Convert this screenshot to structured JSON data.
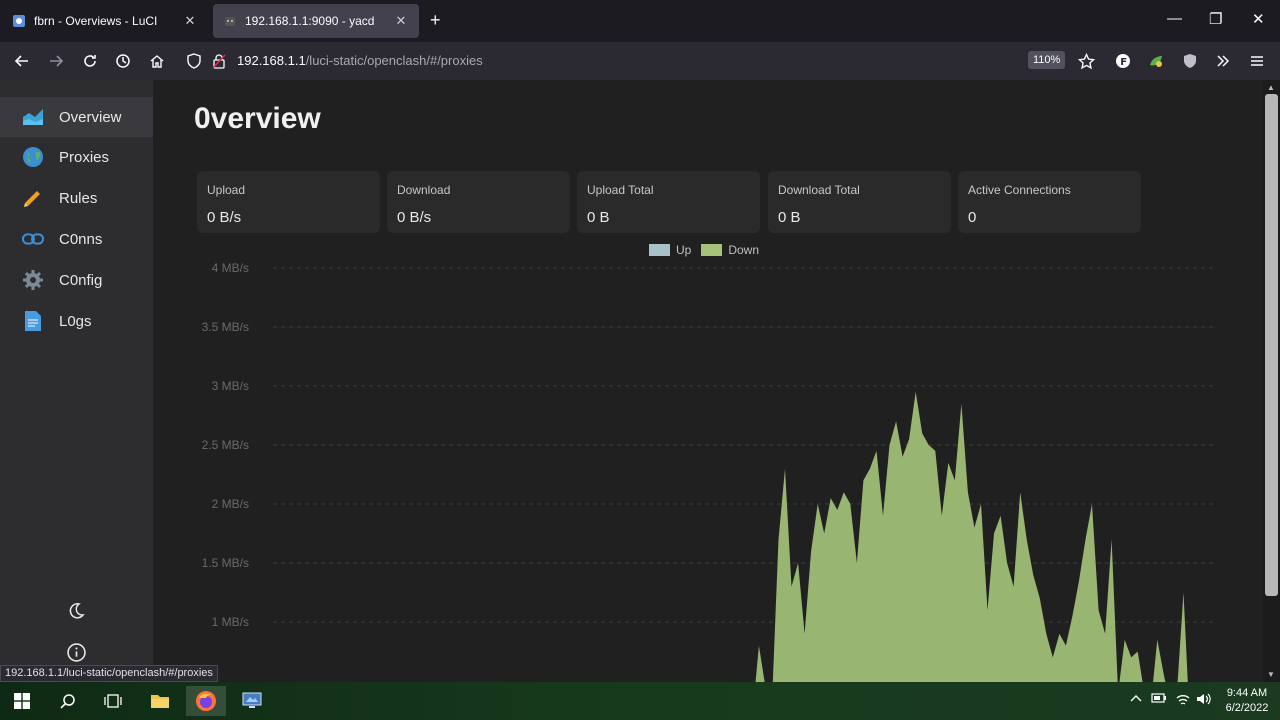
{
  "browser": {
    "tabs": [
      {
        "title": "fbrn - Overviews - LuCI",
        "active": false
      },
      {
        "title": "192.168.1.1:9090 - yacd",
        "active": true
      }
    ],
    "url_host": "192.168.1.1",
    "url_path": "/luci-static/openclash/#/proxies",
    "zoom": "110%",
    "status_url": "192.168.1.1/luci-static/openclash/#/proxies"
  },
  "sidebar": {
    "items": [
      {
        "label": "Overview",
        "icon": "chart-area-icon",
        "active": true
      },
      {
        "label": "Proxies",
        "icon": "globe-icon",
        "active": false
      },
      {
        "label": "Rules",
        "icon": "ruler-icon",
        "active": false
      },
      {
        "label": "C0nns",
        "icon": "link-icon",
        "active": false
      },
      {
        "label": "C0nfig",
        "icon": "gear-icon",
        "active": false
      },
      {
        "label": "L0gs",
        "icon": "document-icon",
        "active": false
      }
    ]
  },
  "main": {
    "title": "0verview",
    "stats": [
      {
        "label": "Upload",
        "value": "0 B/s"
      },
      {
        "label": "Download",
        "value": "0 B/s"
      },
      {
        "label": "Upload Total",
        "value": "0 B"
      },
      {
        "label": "Download Total",
        "value": "0 B"
      },
      {
        "label": "Active Connections",
        "value": "0"
      }
    ]
  },
  "colors": {
    "up": "#a8c3c8",
    "down": "#a4c27a",
    "accent": "#3a97d4"
  },
  "chart_data": {
    "type": "area",
    "series": [
      {
        "name": "Up",
        "values": []
      },
      {
        "name": "Down",
        "values": [
          0,
          0.45,
          0.2,
          0.8,
          0.45,
          0,
          1.7,
          2.3,
          1.3,
          1.5,
          0.9,
          1.6,
          2.0,
          1.75,
          2.05,
          1.95,
          2.1,
          2.0,
          1.5,
          2.2,
          2.3,
          2.45,
          1.9,
          2.5,
          2.7,
          2.4,
          2.55,
          2.95,
          2.6,
          2.5,
          2.45,
          1.9,
          2.35,
          2.2,
          2.85,
          2.1,
          1.8,
          2.0,
          1.1,
          1.75,
          1.9,
          1.5,
          1.3,
          2.1,
          1.7,
          1.4,
          1.2,
          0.9,
          0.7,
          0.9,
          0.8,
          1.05,
          1.35,
          1.7,
          2.0,
          1.1,
          0.9,
          1.7,
          0.4,
          0.85,
          0.7,
          0.75,
          0.4,
          0.3,
          0.85,
          0.55,
          0.3,
          0.4,
          1.25,
          0.1
        ]
      }
    ],
    "x_start_fraction": 0.495,
    "yticks": [
      "4 MB/s",
      "3.5 MB/s",
      "3 MB/s",
      "2.5 MB/s",
      "2 MB/s",
      "1.5 MB/s",
      "1 MB/s"
    ],
    "ylim": [
      0.5,
      4
    ],
    "grid": true,
    "legend": "top-center"
  },
  "taskbar": {
    "time": "9:44 AM",
    "date": "6/2/2022"
  }
}
